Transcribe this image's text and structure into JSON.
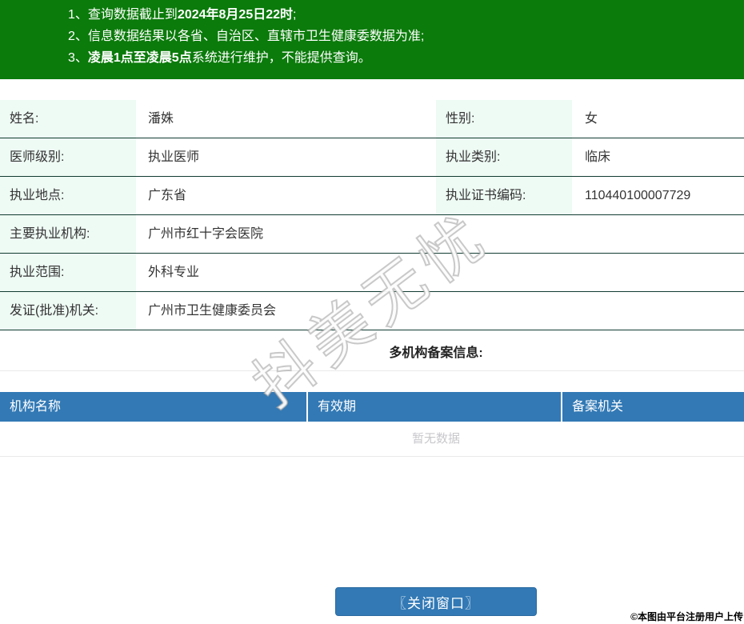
{
  "colors": {
    "green": "#0b7b0b",
    "blue": "#3279b5",
    "label_bg": "#eefaf4",
    "border_dark": "#113c31",
    "light_border": "#e9e9e9",
    "empty_text": "#c8c8cc",
    "text": "#333333"
  },
  "notice": {
    "items": [
      {
        "num": "1、",
        "pre": "查询数据截止到",
        "bold": "2024年8月25日22时",
        "post": ";"
      },
      {
        "num": "2、",
        "pre": "信息数据结果以各省、自治区、直辖市卫生健康委数据为准;",
        "bold": "",
        "post": ""
      },
      {
        "num": "3、",
        "pre": "",
        "bold": "凌晨1点至凌晨5点",
        "post": "系统进行维护，不能提供查询。"
      }
    ]
  },
  "info": {
    "rows": [
      {
        "cells": [
          {
            "label": "姓名:",
            "value": "潘姝"
          },
          {
            "label": "性别:",
            "value": "女"
          }
        ]
      },
      {
        "cells": [
          {
            "label": "医师级别:",
            "value": "执业医师"
          },
          {
            "label": "执业类别:",
            "value": "临床"
          }
        ]
      },
      {
        "cells": [
          {
            "label": "执业地点:",
            "value": "广东省"
          },
          {
            "label": "执业证书编码:",
            "value": "110440100007729"
          }
        ]
      },
      {
        "cells": [
          {
            "label": "主要执业机构:",
            "value": "广州市红十字会医院"
          }
        ]
      },
      {
        "cells": [
          {
            "label": "执业范围:",
            "value": "外科专业"
          }
        ]
      },
      {
        "cells": [
          {
            "label": "发证(批准)机关:",
            "value": "广州市卫生健康委员会"
          }
        ]
      }
    ]
  },
  "filing": {
    "title": "多机构备案信息:",
    "headers": [
      "机构名称",
      "有效期",
      "备案机关"
    ],
    "empty_text": "暂无数据"
  },
  "footer": {
    "close_button": "〖关闭窗口〗",
    "copyright": "©本图由平台注册用户上传"
  },
  "watermark": {
    "text": "抖美无忧"
  }
}
